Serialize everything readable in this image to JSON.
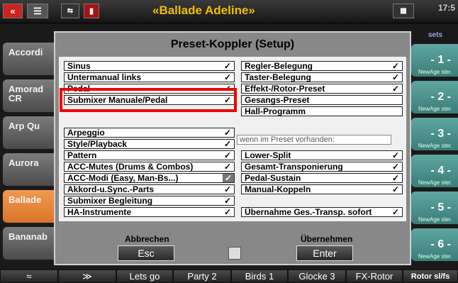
{
  "topbar": {
    "title": "«Ballade Adeline»",
    "clock": "17:5",
    "icons": [
      "back-double-icon",
      "menu-icon",
      "usb-icon",
      "trash-icon",
      "midi-icon"
    ]
  },
  "left_strip": {
    "items": [
      {
        "label": "Accordi"
      },
      {
        "label": "Amorad\nCR"
      },
      {
        "label": "Arp Qu"
      },
      {
        "label": "Aurora"
      },
      {
        "label": "Ballade",
        "selected": true
      },
      {
        "label": "Bananab"
      }
    ]
  },
  "right_strip": {
    "header": "sets",
    "items": [
      {
        "label": "- 1 -",
        "sub": "NewAge ster."
      },
      {
        "label": "- 2 -",
        "sub": "NewAge ster."
      },
      {
        "label": "- 3 -",
        "sub": "NewAge ster."
      },
      {
        "label": "- 4 -",
        "sub": "NewAge ster."
      },
      {
        "label": "- 5 -",
        "sub": "NewAge ster."
      },
      {
        "label": "- 6 -",
        "sub": "NewAge ster."
      }
    ]
  },
  "dialog": {
    "title": "Preset-Koppler (Setup)",
    "left_group1": [
      {
        "label": "Sinus",
        "checked": true
      },
      {
        "label": "Untermanual links",
        "checked": true
      },
      {
        "label": "Pedal",
        "checked": true
      },
      {
        "label": "Submixer Manuale/Pedal",
        "checked": true
      }
    ],
    "left_group2": [
      {
        "label": "Arpeggio",
        "checked": true
      },
      {
        "label": "Style/Playback",
        "checked": true
      },
      {
        "label": "Pattern",
        "checked": true
      },
      {
        "label": "ACC-Mutes (Drums & Combos)",
        "checked": true
      },
      {
        "label": "ACC-Modi (Easy, Man-Bs...)",
        "checked": true
      },
      {
        "label": "Akkord-u.Sync.-Parts",
        "checked": true
      },
      {
        "label": "Submixer Begleitung",
        "checked": true
      },
      {
        "label": "HA-Instrumente",
        "checked": true
      }
    ],
    "right_group1": [
      {
        "label": "Regler-Belegung",
        "checked": true
      },
      {
        "label": "Taster-Belegung",
        "checked": true
      },
      {
        "label": "Effekt-/Rotor-Preset",
        "checked": true
      },
      {
        "label": "Gesangs-Preset",
        "checked": false
      },
      {
        "label": "Hall-Programm",
        "checked": false
      }
    ],
    "info_text": "wenn im Preset vorhanden:",
    "right_group2": [
      {
        "label": "Lower-Split",
        "checked": true
      },
      {
        "label": "Gesamt-Transponierung",
        "checked": true
      },
      {
        "label": "Pedal-Sustain",
        "checked": true
      },
      {
        "label": "Manual-Koppeln",
        "checked": true
      }
    ],
    "uebernahme": {
      "label": "Übernahme Ges.-Transp. sofort",
      "checked": true
    },
    "check_glyph": "✓",
    "cancel": {
      "caption": "Abbrechen",
      "key": "Esc"
    },
    "apply": {
      "caption": "Übernehmen",
      "key": "Enter"
    }
  },
  "bottom_bar": {
    "items": [
      "≈",
      "≫",
      "Lets go",
      "Party 2",
      "Birds 1",
      "Glocke 3",
      "FX-Rotor",
      "Rotor sl/fs"
    ]
  },
  "colors": {
    "title": "#f0c000",
    "highlight_box": "#e00000",
    "selected_item": "#e6843a",
    "preset_tile": "#4a8f89"
  }
}
